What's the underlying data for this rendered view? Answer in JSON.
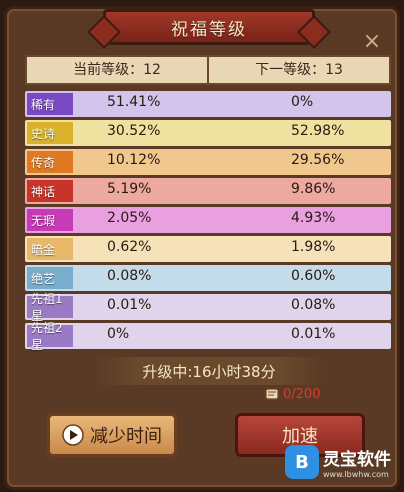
{
  "title": "祝福等级",
  "header": {
    "current_level": "当前等级：12",
    "next_level": "下一等级：13"
  },
  "rows": [
    {
      "tier": "稀有",
      "color": "#7a4ac4",
      "bg": "#d3c4ec",
      "current": "51.41%",
      "next": "0%"
    },
    {
      "tier": "史诗",
      "color": "#d8b22a",
      "bg": "#efe2a0",
      "current": "30.52%",
      "next": "52.98%"
    },
    {
      "tier": "传奇",
      "color": "#e07a22",
      "bg": "#f0c88e",
      "current": "10.12%",
      "next": "29.56%"
    },
    {
      "tier": "神话",
      "color": "#c8342a",
      "bg": "#eda8a0",
      "current": "5.19%",
      "next": "9.86%"
    },
    {
      "tier": "无瑕",
      "color": "#c63ab8",
      "bg": "#e8a0e0",
      "current": "2.05%",
      "next": "4.93%"
    },
    {
      "tier": "暗金",
      "color": "#e8b86a",
      "bg": "#f6e2b8",
      "current": "0.62%",
      "next": "1.98%"
    },
    {
      "tier": "绝艺",
      "color": "#7aaccc",
      "bg": "#c4dcea",
      "current": "0.08%",
      "next": "0.60%"
    },
    {
      "tier": "先祖1星",
      "color": "#9a7ac4",
      "bg": "#e0d4ec",
      "current": "0.01%",
      "next": "0.08%"
    },
    {
      "tier": "先祖2星",
      "color": "#9a7ac4",
      "bg": "#e0d4ec",
      "current": "0%",
      "next": "0.01%"
    }
  ],
  "upgrade_status": "升级中:16小时38分",
  "scroll_count": "0/200",
  "buttons": {
    "reduce_time": "减少时间",
    "speed_up": "加速"
  },
  "watermark": {
    "logo_text": "B",
    "name": "灵宝软件",
    "url": "www.lbwhw.com"
  }
}
